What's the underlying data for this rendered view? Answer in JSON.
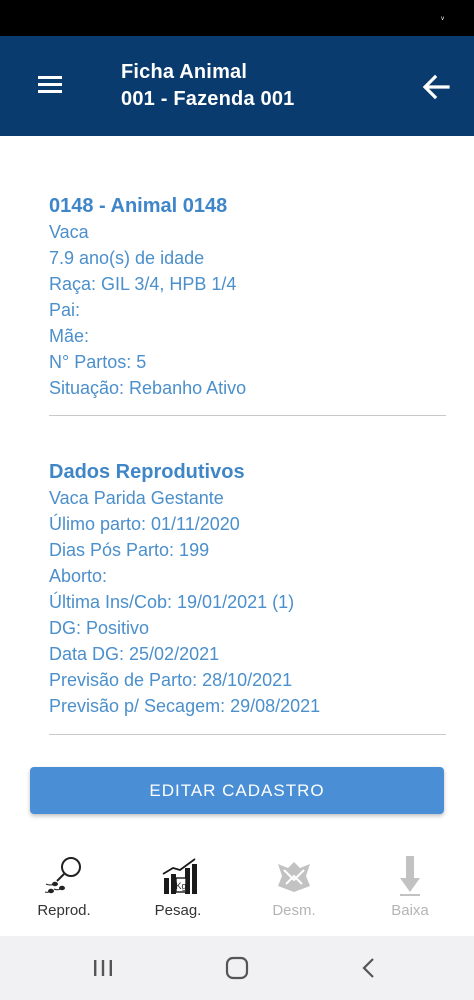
{
  "status_bar": {
    "glyph": "ᵛ"
  },
  "header": {
    "title": "Ficha Animal",
    "subtitle": "001 - Fazenda 001",
    "menu_icon": "hamburger-menu-icon",
    "back_icon": "arrow-left-icon",
    "background_color": "#0a3b6e"
  },
  "animal": {
    "heading": "0148 - Animal 0148",
    "lines": [
      "Vaca",
      "7.9 ano(s) de idade",
      "Raça: GIL 3/4, HPB 1/4",
      "Pai:",
      "Mãe:",
      "N° Partos: 5",
      "Situação: Rebanho Ativo"
    ]
  },
  "reproductive": {
    "heading": "Dados Reprodutivos",
    "lines": [
      "Vaca Parida Gestante",
      "Úlimo parto: 01/11/2020",
      "Dias Pós Parto: 199",
      "Aborto:",
      "Última Ins/Cob: 19/01/2021 (1)",
      "DG: Positivo",
      "Data DG: 25/02/2021",
      "Previsão de Parto: 28/10/2021",
      "Previsão p/ Secagem: 29/08/2021"
    ]
  },
  "actions": {
    "edit_label": "EDITAR CADASTRO",
    "accent_color": "#4a8fd6"
  },
  "bottom_nav": {
    "items": [
      {
        "label": "Reprod.",
        "icon": "reproduction-icon",
        "enabled": true
      },
      {
        "label": "Pesag.",
        "icon": "weighing-scale-icon",
        "enabled": true
      },
      {
        "label": "Desm.",
        "icon": "weaning-icon",
        "enabled": false
      },
      {
        "label": "Baixa",
        "icon": "arrow-down-icon",
        "enabled": false
      }
    ]
  },
  "system_nav": {
    "recents_icon": "recents-icon",
    "home_icon": "home-icon",
    "back_icon": "back-chevron-icon"
  }
}
